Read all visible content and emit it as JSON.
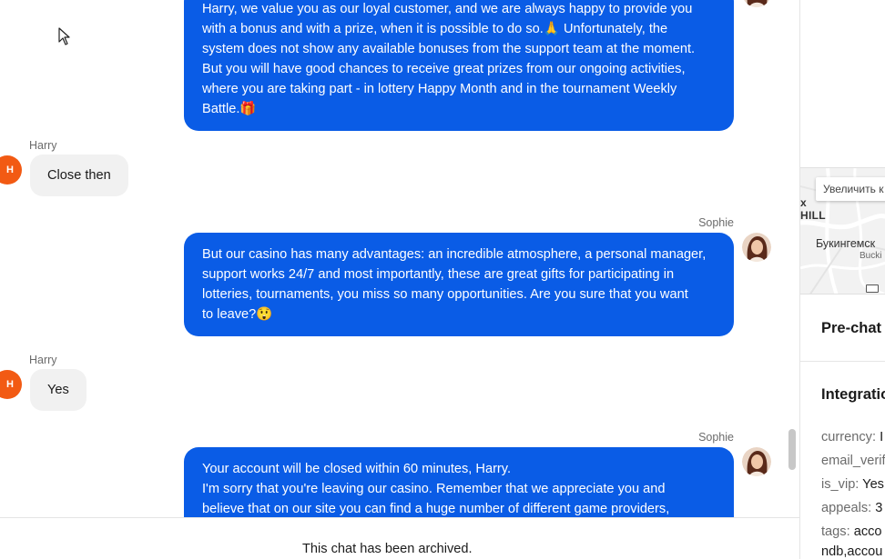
{
  "chat": {
    "messages": [
      {
        "sender": "Sophie",
        "lines": [
          "Harry, we value you as our loyal customer, and we are always happy to provide you",
          "with a bonus and with a prize, when it is possible to do so.🙏 Unfortunately, the",
          "system does not show any available bonuses from the support team at the moment.",
          "But you will have good chances to receive great prizes from our ongoing activities,",
          "where you are taking part - in lottery Happy Month and in the tournament Weekly",
          "Battle.🎁"
        ]
      },
      {
        "sender": "Harry",
        "avatar_initial": "H",
        "text": "Close then"
      },
      {
        "sender": "Sophie",
        "lines": [
          "But our casino has many advantages: an incredible atmosphere, a personal manager,",
          "support works 24/7 and most importantly, these are great gifts for participating in",
          "lotteries, tournaments, you miss so many opportunities. Are you sure that you want",
          "to leave?😲"
        ]
      },
      {
        "sender": "Harry",
        "avatar_initial": "H",
        "text": "Yes"
      },
      {
        "sender": "Sophie",
        "lines": [
          "Your account will be closed within 60 minutes, Harry.",
          "I'm sorry that you're leaving our casino. Remember that we appreciate you and",
          "believe that on our site you can find a huge number of different game providers,"
        ]
      }
    ],
    "archived_notice": "This chat has been archived."
  },
  "sidebar": {
    "map": {
      "zoom_label": "Увеличить к",
      "area_label": "HILL",
      "area_prefix": "x",
      "city_label": "Букингемск",
      "city_sub_label": "Bucki"
    },
    "prechat_heading": "Pre-chat",
    "integration_heading": "Integratio",
    "fields": [
      {
        "key": "currency:",
        "value": "I"
      },
      {
        "key": "email_verif",
        "value": ""
      },
      {
        "key": "is_vip:",
        "value": "Yes"
      },
      {
        "key": "appeals:",
        "value": "3"
      },
      {
        "key": "tags:",
        "value": "acco"
      }
    ],
    "tags_continued": "ndb,accou"
  },
  "colors": {
    "agent_bubble": "#0a5ce6",
    "user_bubble": "#f1f1f1",
    "user_avatar": "#f25a13"
  }
}
